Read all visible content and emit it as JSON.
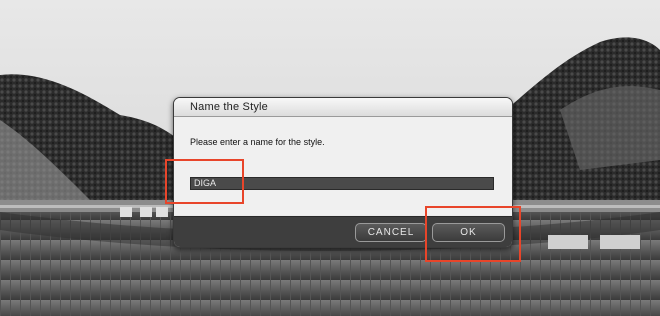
{
  "dialog": {
    "title": "Name the Style",
    "prompt": "Please enter a name for the style.",
    "name_field": {
      "value": "DIGA"
    },
    "buttons": {
      "cancel": "CANCEL",
      "ok": "OK"
    }
  },
  "colors": {
    "highlight": "#e8452a",
    "footer": "#3e3e3e",
    "field": "#4a4a4a"
  }
}
